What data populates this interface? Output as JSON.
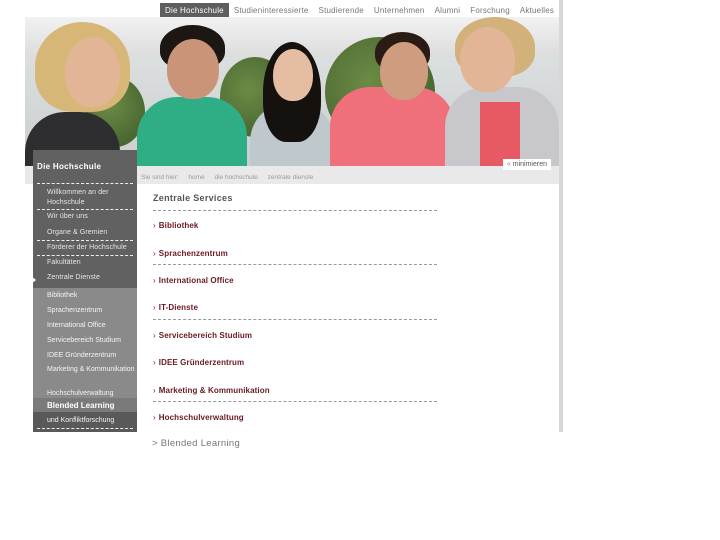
{
  "topnav": {
    "items": [
      "Die Hochschule",
      "Studieninteressierte",
      "Studierende",
      "Unternehmen",
      "Alumni",
      "Forschung",
      "Aktuelles"
    ],
    "active_index": 0
  },
  "hero": {
    "minimize_label": "minimieren",
    "minimize_icon": "double-chevron-icon"
  },
  "sidebar": {
    "title": "Die Hochschule",
    "items": [
      "Willkommen an der Hochschule",
      "Wir über uns",
      "Organe & Gremien",
      "Förderer der Hochschule",
      "Fakultäten",
      "Zentrale Dienste"
    ],
    "sub_items": [
      "Bibliothek",
      "Sprachenzentrum",
      "International Office",
      "Servicebereich Studium",
      "IDEE Gründerzentrum",
      "Marketing & Kommunikation",
      "Hochschulverwaltung",
      "Blended Learning"
    ],
    "active_sub": "Blended Learning",
    "bottom_item": "und Konfliktforschung"
  },
  "breadcrumb": {
    "prefix": "Sie sind hier:",
    "items": [
      "home",
      "die hochschule",
      "zentrale dienste"
    ]
  },
  "content": {
    "title": "Zentrale Services",
    "services": [
      "Bibliothek",
      "Sprachenzentrum",
      "International Office",
      "IT-Dienste",
      "Servicebereich Studium",
      "IDEE Gründerzentrum",
      "Marketing & Kommunikation",
      "Hochschulverwaltung"
    ],
    "chevron": "›"
  },
  "footer_link": "> Blended Learning",
  "colors": {
    "nav_active": "#5e5e5e",
    "sidebar": "#616161",
    "sidebar_sub": "#8a8a8a",
    "service_link": "#6a1a20"
  }
}
